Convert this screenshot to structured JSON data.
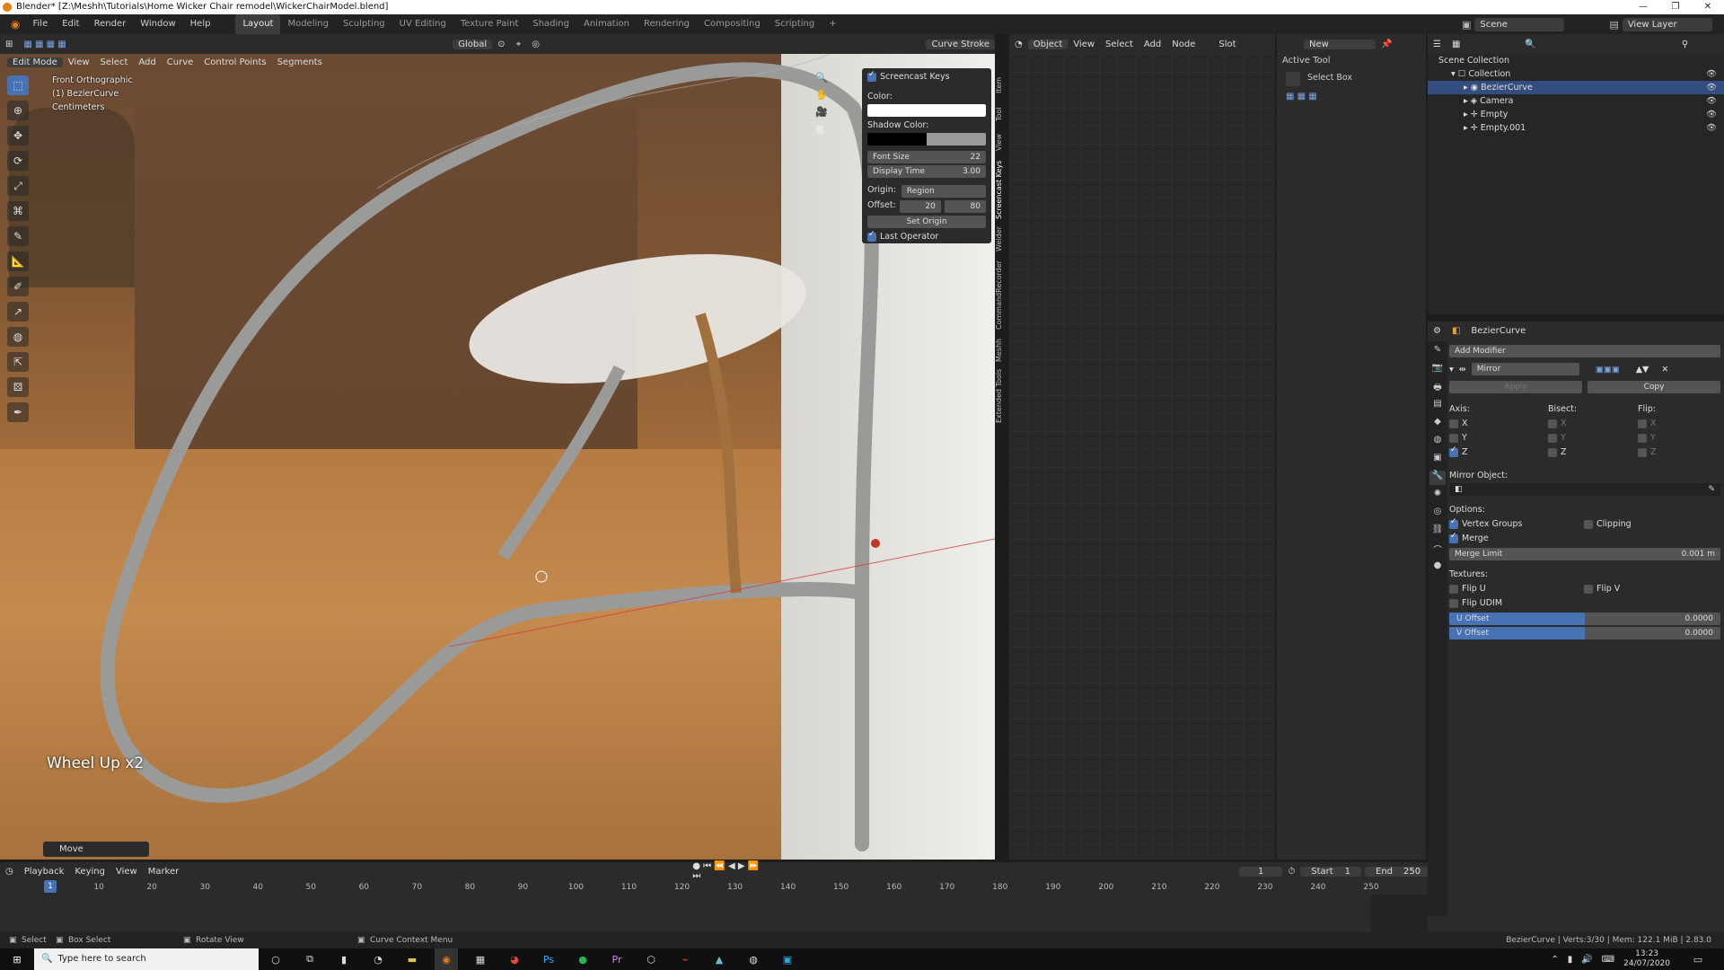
{
  "window": {
    "title": "Blender* [Z:\\Meshh\\Tutorials\\Home Wicker Chair remodel\\WickerChairModel.blend]",
    "controls": [
      "—",
      "❐",
      "✕"
    ]
  },
  "menu": {
    "items": [
      "File",
      "Edit",
      "Render",
      "Window",
      "Help"
    ],
    "workspaces": [
      "Layout",
      "Modeling",
      "Sculpting",
      "UV Editing",
      "Texture Paint",
      "Shading",
      "Animation",
      "Rendering",
      "Compositing",
      "Scripting",
      "+"
    ],
    "active_workspace": "Layout",
    "scene": "Scene",
    "view_layer": "View Layer"
  },
  "viewport_header": {
    "mode": "Edit Mode",
    "menus": [
      "View",
      "Select",
      "Add",
      "Curve",
      "Control Points",
      "Segments"
    ],
    "transform": "Global",
    "curve_stroke": "Curve Stroke"
  },
  "overlay": {
    "view_name": "Front Orthographic",
    "object": "(1) BezierCurve",
    "units": "Centimeters",
    "keys": "Wheel Up x2",
    "last_op": "Move"
  },
  "npanel": {
    "title": "Screencast Keys",
    "color_label": "Color:",
    "shadow_label": "Shadow Color:",
    "font_size_label": "Font Size",
    "font_size": "22",
    "display_time_label": "Display Time",
    "display_time": "3.00",
    "origin_label": "Origin:",
    "origin": "Region",
    "offset_label": "Offset:",
    "offset_x": "20",
    "offset_y": "80",
    "set_origin": "Set Origin",
    "last_operator": "Last Operator",
    "tabs": [
      "Item",
      "Tool",
      "View",
      "Screencast Keys",
      "Weider",
      "CommandRecorder",
      "Meshh",
      "Extended Tools"
    ]
  },
  "node_header": {
    "object": "Object",
    "menus": [
      "View",
      "Select",
      "Add",
      "Node"
    ],
    "slot": "Slot",
    "new": "New"
  },
  "active_tool": {
    "title": "Active Tool",
    "tool": "Select Box"
  },
  "outliner": {
    "rows": [
      {
        "label": "Scene Collection",
        "indent": 0,
        "selected": false
      },
      {
        "label": "Collection",
        "indent": 1,
        "selected": false
      },
      {
        "label": "BezierCurve",
        "indent": 2,
        "selected": true
      },
      {
        "label": "Camera",
        "indent": 2,
        "selected": false
      },
      {
        "label": "Empty",
        "indent": 2,
        "selected": false
      },
      {
        "label": "Empty.001",
        "indent": 2,
        "selected": false
      }
    ]
  },
  "properties": {
    "object": "BezierCurve",
    "add_modifier": "Add Modifier",
    "modifier_name": "Mirror",
    "apply": "Apply",
    "copy": "Copy",
    "axis_label": "Axis:",
    "bisect_label": "Bisect:",
    "flip_label": "Flip:",
    "axes": [
      {
        "name": "X",
        "axis": false,
        "bisect": false,
        "flip": false
      },
      {
        "name": "Y",
        "axis": false,
        "bisect": false,
        "flip": false
      },
      {
        "name": "Z",
        "axis": true,
        "bisect": false,
        "flip": false
      }
    ],
    "mirror_object_label": "Mirror Object:",
    "options_label": "Options:",
    "vertex_groups": "Vertex Groups",
    "clipping": "Clipping",
    "merge": "Merge",
    "merge_limit_label": "Merge Limit",
    "merge_limit": "0.001 m",
    "textures_label": "Textures:",
    "flip_u": "Flip U",
    "flip_v": "Flip V",
    "flip_udim": "Flip UDIM",
    "u_offset_label": "U Offset",
    "u_offset": "0.0000",
    "v_offset_label": "V Offset",
    "v_offset": "0.0000"
  },
  "timeline": {
    "menus": [
      "Playback",
      "Keying",
      "View",
      "Marker"
    ],
    "current_frame": "1",
    "start_label": "Start",
    "start": "1",
    "end_label": "End",
    "end": "250",
    "ticks": [
      "1",
      "10",
      "20",
      "30",
      "40",
      "50",
      "60",
      "70",
      "80",
      "90",
      "100",
      "110",
      "120",
      "130",
      "140",
      "150",
      "160",
      "170",
      "180",
      "190",
      "200",
      "210",
      "220",
      "230",
      "240",
      "250"
    ]
  },
  "statusbar": {
    "select": "Select",
    "box_select": "Box Select",
    "rotate_view": "Rotate View",
    "context_menu": "Curve Context Menu",
    "stats": "BezierCurve | Verts:3/30 | Mem: 122.1 MiB | 2.83.0"
  },
  "taskbar": {
    "search_placeholder": "Type here to search",
    "time": "13:23",
    "date": "24/07/2020"
  }
}
